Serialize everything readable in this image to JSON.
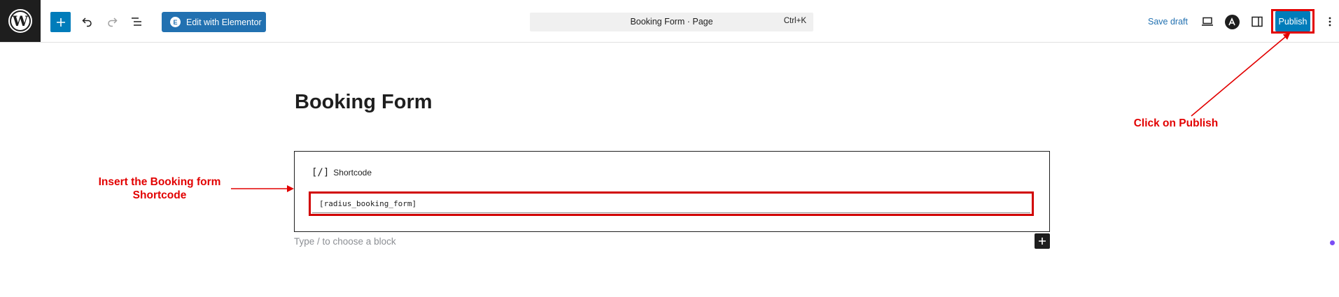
{
  "topbar": {
    "edit_with_elementor_label": "Edit with Elementor",
    "document_title": "Booking Form · Page",
    "command_shortcut": "Ctrl+K",
    "save_draft_label": "Save draft",
    "publish_label": "Publish"
  },
  "editor": {
    "page_title": "Booking Form",
    "block": {
      "label_icon": "[/]",
      "label": "Shortcode",
      "value": "[radius_booking_form]"
    },
    "placeholder": "Type / to choose a block"
  },
  "annotations": {
    "left": [
      "Insert the Booking form",
      "Shortcode"
    ],
    "right": "Click on Publish",
    "color": "#e20000"
  },
  "colors": {
    "primary": "#007cba",
    "elementor": "#2271b1",
    "dark": "#1e1e1e"
  },
  "icons": [
    "wordpress-logo-icon",
    "plus-icon",
    "undo-icon",
    "redo-icon",
    "list-view-icon",
    "elementor-icon",
    "desktop-preview-icon",
    "astra-icon",
    "sidebar-icon",
    "more-vertical-icon"
  ]
}
